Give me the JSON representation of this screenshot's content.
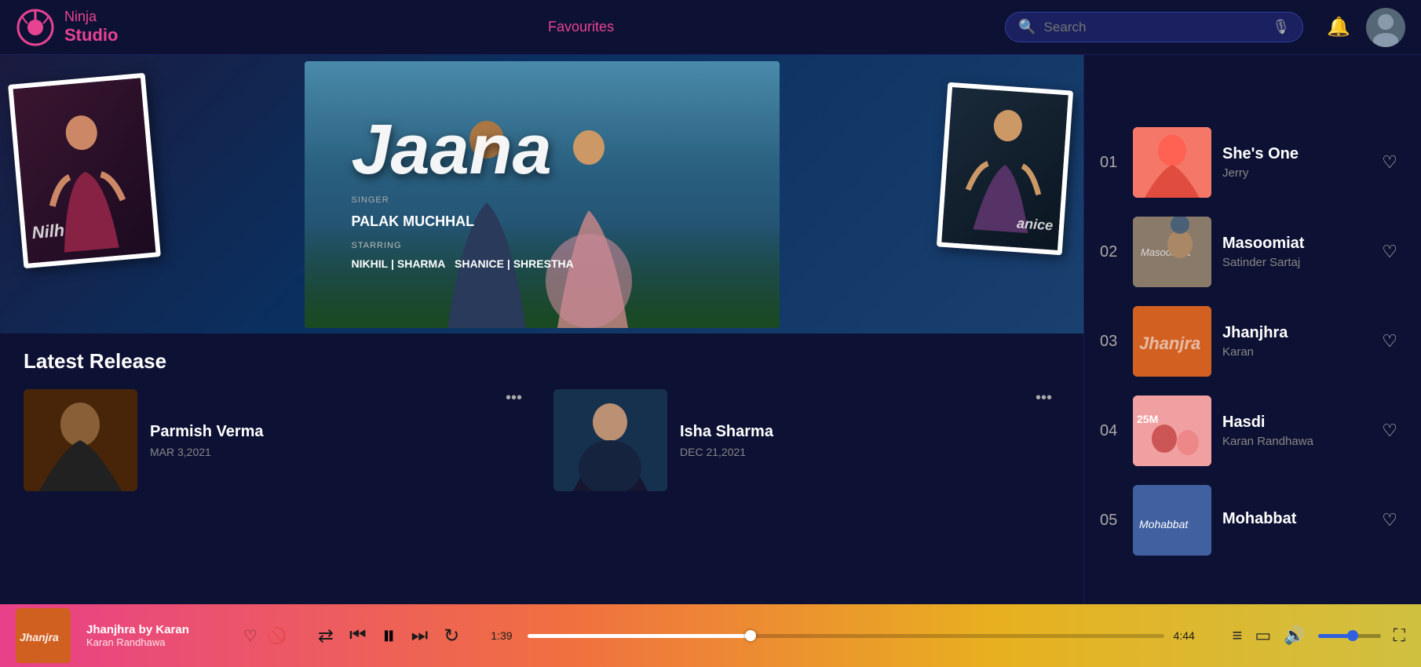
{
  "header": {
    "logo_line1": "Ninja",
    "logo_line2": "Studio",
    "nav_items": [
      "Favourites"
    ],
    "search_placeholder": "Search",
    "notification_icon": "bell-icon",
    "avatar_icon": "user-avatar"
  },
  "hero": {
    "calligraphy": "Jaana",
    "left_card_text": "Nilh",
    "right_card_text": "anice",
    "singer_label": "SINGER",
    "singer_name": "PALAK MUCHHAL",
    "starring_label": "STARRING",
    "star1": "NIKHIL",
    "star2": "SHARMA",
    "star3": "SHANICE",
    "star4": "SHRESTHA"
  },
  "latest_release": {
    "title": "Latest Release",
    "cards": [
      {
        "name": "Parmish Verma",
        "date": "MAR 3,2021"
      },
      {
        "name": "Isha Sharma",
        "date": "DEC 21,2021"
      }
    ]
  },
  "trending": {
    "items": [
      {
        "num": "01",
        "song": "She's One",
        "artist": "Jerry",
        "heart": "♡"
      },
      {
        "num": "02",
        "song": "Masoomiat",
        "artist": "Satinder Sartaj",
        "heart": "♡"
      },
      {
        "num": "03",
        "song": "Jhanjhra",
        "artist": "Karan",
        "heart": "♡"
      },
      {
        "num": "04",
        "song": "Hasdi",
        "artist": "Karan Randhawa",
        "heart": "♡"
      },
      {
        "num": "05",
        "song": "Mohabbat",
        "artist": "",
        "heart": "♡"
      }
    ]
  },
  "player": {
    "song_name": "Jhanjhra by Karan",
    "artist": "Karan Randhawa",
    "time_current": "1:39",
    "time_total": "4:44",
    "progress_percent": 35,
    "volume_percent": 55,
    "heart_icon": "♡",
    "block_icon": "🚫",
    "shuffle_icon": "⇄",
    "prev_icon": "⏮",
    "pause_icon": "⏸",
    "next_icon": "⏭",
    "repeat_icon": "↻",
    "list_icon": "≡",
    "screen_icon": "▭",
    "volume_icon": "🔊",
    "expand_icon": "⛶"
  }
}
